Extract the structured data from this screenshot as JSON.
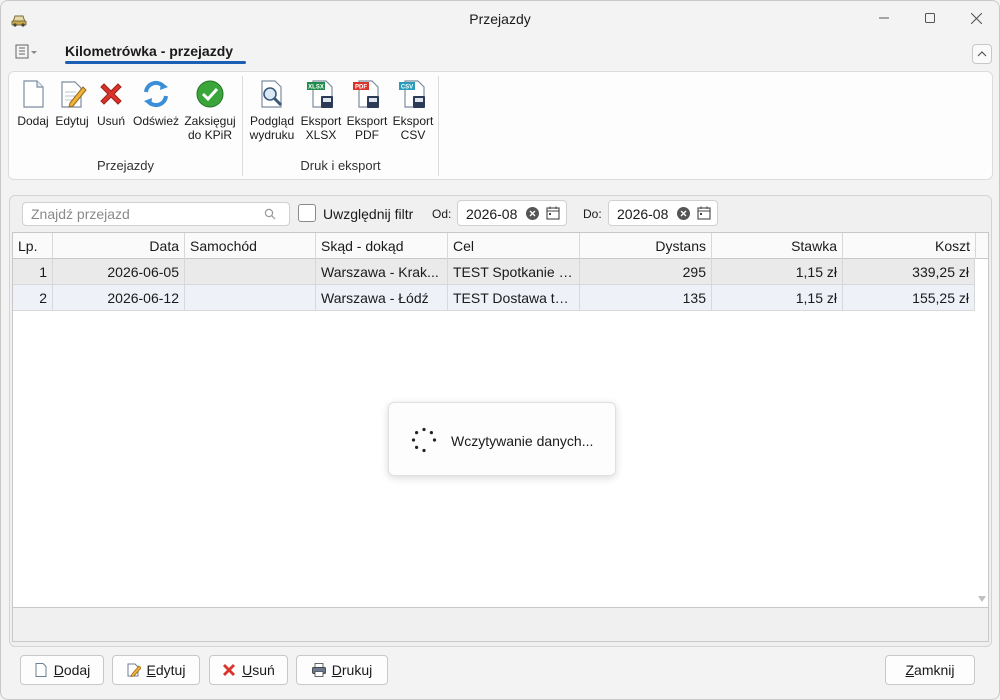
{
  "window": {
    "title": "Przejazdy"
  },
  "ribbon": {
    "active_tab": "Kilometrówka - przejazdy",
    "groups": [
      {
        "label": "Przejazdy",
        "buttons": [
          "Dodaj",
          "Edytuj",
          "Usuń",
          "Odśwież",
          "Zaksięguj\ndo KPiR"
        ]
      },
      {
        "label": "Druk i eksport",
        "buttons": [
          "Podgląd\nwydruku",
          "Eksport\nXLSX",
          "Eksport\nPDF",
          "Eksport\nCSV"
        ]
      }
    ],
    "icons": {
      "xlsx": "XLSX",
      "pdf": "PDF",
      "csv": "CSV"
    }
  },
  "filter": {
    "search_placeholder": "Znajdź przejazd",
    "include_filter_label": "Uwzględnij filtr",
    "include_filter_checked": false,
    "from_label": "Od:",
    "from_value": "2026-08-",
    "to_label": "Do:",
    "to_value": "2026-08-"
  },
  "table": {
    "columns": [
      "Lp.",
      "Data",
      "Samochód",
      "Skąd - dokąd",
      "Cel",
      "Dystans",
      "Stawka",
      "Koszt"
    ],
    "rows": [
      [
        "1",
        "2026-06-05",
        "",
        "Warszawa - Krak...",
        "TEST Spotkanie z...",
        "295",
        "1,15 zł",
        "339,25 zł"
      ],
      [
        "2",
        "2026-06-12",
        "",
        "Warszawa - Łódź",
        "TEST Dostawa to...",
        "135",
        "1,15 zł",
        "155,25 zł"
      ]
    ]
  },
  "loading": {
    "text": "Wczytywanie danych..."
  },
  "bottom_buttons": {
    "add": {
      "key": "D",
      "rest": "odaj"
    },
    "edit": {
      "key": "E",
      "rest": "dytuj"
    },
    "delete": {
      "key": "U",
      "rest": "suń"
    },
    "print": {
      "key": "D",
      "rest": "rukuj"
    },
    "close": {
      "key": "Z",
      "rest": "amknij"
    }
  },
  "colors": {
    "accent": "#1a5fb4",
    "delete_red": "#d9342b",
    "confirm_green": "#3aa63a"
  }
}
